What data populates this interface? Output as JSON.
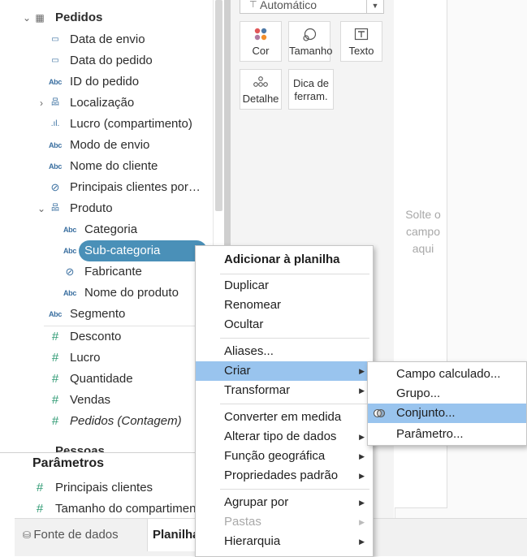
{
  "data_pane": {
    "table_name": "Pedidos",
    "fields": [
      {
        "label": "Data de envio",
        "icon": "calendar-icon",
        "glyph": "▭"
      },
      {
        "label": "Data do pedido",
        "icon": "calendar-icon",
        "glyph": "▭"
      },
      {
        "label": "ID do pedido",
        "icon": "abc-icon",
        "glyph": "Abc"
      },
      {
        "label": "Localização",
        "icon": "hierarchy-icon",
        "glyph": "品"
      },
      {
        "label": "Lucro (compartimento)",
        "icon": "bin-icon",
        "glyph": ".ıl."
      },
      {
        "label": "Modo de envio",
        "icon": "abc-icon",
        "glyph": "Abc"
      },
      {
        "label": "Nome do cliente",
        "icon": "abc-icon",
        "glyph": "Abc"
      },
      {
        "label": "Principais clientes por…",
        "icon": "set-icon",
        "glyph": "⊘"
      },
      {
        "label": "Produto",
        "icon": "hierarchy-icon",
        "glyph": "品"
      },
      {
        "label": "Categoria",
        "icon": "abc-icon",
        "glyph": "Abc"
      },
      {
        "label": "Sub-categoria",
        "icon": "abc-icon",
        "glyph": "Abc"
      },
      {
        "label": "Fabricante",
        "icon": "paperclip-icon",
        "glyph": "⊘"
      },
      {
        "label": "Nome do produto",
        "icon": "abc-icon",
        "glyph": "Abc"
      },
      {
        "label": "Segmento",
        "icon": "abc-icon",
        "glyph": "Abc"
      }
    ],
    "measures": [
      {
        "label": "Desconto",
        "glyph": "#"
      },
      {
        "label": "Lucro",
        "glyph": "#"
      },
      {
        "label": "Quantidade",
        "glyph": "#"
      },
      {
        "label": "Vendas",
        "glyph": "#"
      },
      {
        "label": "Pedidos (Contagem)",
        "glyph": "#"
      }
    ],
    "next_table_partial": "Pessoas"
  },
  "parameters": {
    "title": "Parâmetros",
    "items": [
      {
        "label": "Principais clientes",
        "glyph": "#"
      },
      {
        "label": "Tamanho do compartimento",
        "glyph": "#"
      }
    ]
  },
  "bottom_tabs": {
    "data_source": "Fonte de dados",
    "worksheet": "Planilha"
  },
  "marks": {
    "mark_type": "Automático",
    "buttons": [
      {
        "label": "Cor"
      },
      {
        "label": "Tamanho"
      },
      {
        "label": "Texto"
      },
      {
        "label": "Detalhe"
      },
      {
        "label": "Dica de ferram."
      }
    ]
  },
  "view": {
    "drop_hint": "Solte o campo aqui"
  },
  "context_menu": {
    "items": [
      {
        "label": "Adicionar à planilha",
        "bold": true
      },
      {
        "label": "Duplicar"
      },
      {
        "label": "Renomear"
      },
      {
        "label": "Ocultar"
      },
      {
        "label": "Aliases..."
      },
      {
        "label": "Criar",
        "submenu": true,
        "highlighted": true
      },
      {
        "label": "Transformar",
        "submenu": true
      },
      {
        "label": "Converter em medida"
      },
      {
        "label": "Alterar tipo de dados",
        "submenu": true
      },
      {
        "label": "Função geográfica",
        "submenu": true
      },
      {
        "label": "Propriedades padrão",
        "submenu": true
      },
      {
        "label": "Agrupar por",
        "submenu": true
      },
      {
        "label": "Pastas",
        "submenu": true,
        "disabled": true
      },
      {
        "label": "Hierarquia",
        "submenu": true
      }
    ]
  },
  "sub_menu": {
    "items": [
      {
        "label": "Campo calculado..."
      },
      {
        "label": "Grupo..."
      },
      {
        "label": "Conjunto...",
        "highlighted": true
      },
      {
        "label": "Parâmetro..."
      }
    ]
  },
  "colors": {
    "selection_pill": "#4a90b8",
    "menu_highlight": "#99c4ee",
    "dimension_icon": "#3a6fa0",
    "measure_icon": "#2e9a73"
  }
}
